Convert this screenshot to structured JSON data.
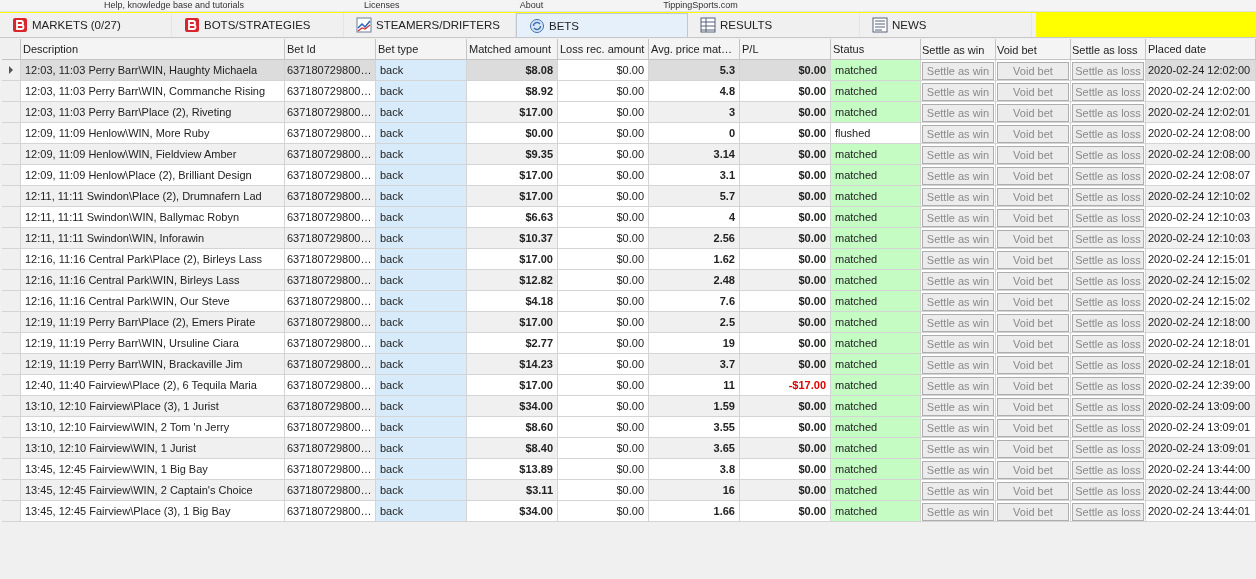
{
  "menu_strip": [
    "Help, knowledge base and tutorials",
    "Licenses",
    "About",
    "TippingSports.com"
  ],
  "tabs": [
    {
      "label": "MARKETS (0/27)",
      "kind": "brand",
      "selected": false
    },
    {
      "label": "BOTS/STRATEGIES",
      "kind": "brand",
      "selected": false
    },
    {
      "label": "STEAMERS/DRIFTERS",
      "kind": "chart",
      "selected": false
    },
    {
      "label": "BETS",
      "kind": "cycle",
      "selected": true
    },
    {
      "label": "RESULTS",
      "kind": "table",
      "selected": false
    },
    {
      "label": "NEWS",
      "kind": "news",
      "selected": false
    }
  ],
  "table": {
    "columns": [
      "Description",
      "Bet Id",
      "Bet type",
      "Matched amount",
      "Loss rec. amount",
      "Avg. price mat…",
      "P/L",
      "Status",
      "Settle as win",
      "Void bet",
      "Settle as loss",
      "Placed date"
    ],
    "rows": [
      {
        "selected": true,
        "description": "12:03, 11:03 Perry Barr\\WIN, Haughty Michaela",
        "bet_id": "637180729800…",
        "bet_type": "back",
        "matched": "$8.08",
        "loss_rec": "$0.00",
        "avg_price": "5.3",
        "pl": "$0.00",
        "pl_negative": false,
        "status": "matched",
        "status_highlight": true,
        "actions": [
          {
            "label": "Settle as win",
            "disabled": true
          },
          {
            "label": "Void bet",
            "disabled": true
          },
          {
            "label": "Settle as loss",
            "disabled": true
          }
        ],
        "placed": "2020-02-24 12:02:00"
      },
      {
        "selected": false,
        "description": "12:03, 11:03 Perry Barr\\WIN, Commanche Rising",
        "bet_id": "637180729800…",
        "bet_type": "back",
        "matched": "$8.92",
        "loss_rec": "$0.00",
        "avg_price": "4.8",
        "pl": "$0.00",
        "pl_negative": false,
        "status": "matched",
        "status_highlight": true,
        "actions": [
          {
            "label": "Settle as win",
            "disabled": true
          },
          {
            "label": "Void bet",
            "disabled": true
          },
          {
            "label": "Settle as loss",
            "disabled": true
          }
        ],
        "placed": "2020-02-24 12:02:00"
      },
      {
        "selected": false,
        "description": "12:03, 11:03 Perry Barr\\Place (2), Riveting",
        "bet_id": "637180729800…",
        "bet_type": "back",
        "matched": "$17.00",
        "loss_rec": "$0.00",
        "avg_price": "3",
        "pl": "$0.00",
        "pl_negative": false,
        "status": "matched",
        "status_highlight": true,
        "actions": [
          {
            "label": "Settle as win",
            "disabled": true
          },
          {
            "label": "Void bet",
            "disabled": true
          },
          {
            "label": "Settle as loss",
            "disabled": true
          }
        ],
        "placed": "2020-02-24 12:02:01"
      },
      {
        "selected": false,
        "description": "12:09, 11:09 Henlow\\WIN, More Ruby",
        "bet_id": "637180729800…",
        "bet_type": "back",
        "matched": "$0.00",
        "loss_rec": "$0.00",
        "avg_price": "0",
        "pl": "$0.00",
        "pl_negative": false,
        "status": "flushed",
        "status_highlight": false,
        "actions": [
          {
            "label": "Settle as win",
            "disabled": true
          },
          {
            "label": "Void bet",
            "disabled": true
          },
          {
            "label": "Settle as loss",
            "disabled": true
          }
        ],
        "placed": "2020-02-24 12:08:00"
      },
      {
        "selected": false,
        "description": "12:09, 11:09 Henlow\\WIN, Fieldview Amber",
        "bet_id": "637180729800…",
        "bet_type": "back",
        "matched": "$9.35",
        "loss_rec": "$0.00",
        "avg_price": "3.14",
        "pl": "$0.00",
        "pl_negative": false,
        "status": "matched",
        "status_highlight": true,
        "actions": [
          {
            "label": "Settle as win",
            "disabled": true
          },
          {
            "label": "Void bet",
            "disabled": true
          },
          {
            "label": "Settle as loss",
            "disabled": true
          }
        ],
        "placed": "2020-02-24 12:08:00"
      },
      {
        "selected": false,
        "description": "12:09, 11:09 Henlow\\Place (2), Brilliant Design",
        "bet_id": "637180729800…",
        "bet_type": "back",
        "matched": "$17.00",
        "loss_rec": "$0.00",
        "avg_price": "3.1",
        "pl": "$0.00",
        "pl_negative": false,
        "status": "matched",
        "status_highlight": true,
        "actions": [
          {
            "label": "Settle as win",
            "disabled": true
          },
          {
            "label": "Void bet",
            "disabled": true
          },
          {
            "label": "Settle as loss",
            "disabled": true
          }
        ],
        "placed": "2020-02-24 12:08:07"
      },
      {
        "selected": false,
        "description": "12:11, 11:11 Swindon\\Place (2), Drumnafern Lad",
        "bet_id": "637180729800…",
        "bet_type": "back",
        "matched": "$17.00",
        "loss_rec": "$0.00",
        "avg_price": "5.7",
        "pl": "$0.00",
        "pl_negative": false,
        "status": "matched",
        "status_highlight": true,
        "actions": [
          {
            "label": "Settle as win",
            "disabled": true
          },
          {
            "label": "Void bet",
            "disabled": true
          },
          {
            "label": "Settle as loss",
            "disabled": true
          }
        ],
        "placed": "2020-02-24 12:10:02"
      },
      {
        "selected": false,
        "description": "12:11, 11:11 Swindon\\WIN, Ballymac Robyn",
        "bet_id": "637180729800…",
        "bet_type": "back",
        "matched": "$6.63",
        "loss_rec": "$0.00",
        "avg_price": "4",
        "pl": "$0.00",
        "pl_negative": false,
        "status": "matched",
        "status_highlight": true,
        "actions": [
          {
            "label": "Settle as win",
            "disabled": true
          },
          {
            "label": "Void bet",
            "disabled": true
          },
          {
            "label": "Settle as loss",
            "disabled": true
          }
        ],
        "placed": "2020-02-24 12:10:03"
      },
      {
        "selected": false,
        "description": "12:11, 11:11 Swindon\\WIN, Inforawin",
        "bet_id": "637180729800…",
        "bet_type": "back",
        "matched": "$10.37",
        "loss_rec": "$0.00",
        "avg_price": "2.56",
        "pl": "$0.00",
        "pl_negative": false,
        "status": "matched",
        "status_highlight": true,
        "actions": [
          {
            "label": "Settle as win",
            "disabled": true
          },
          {
            "label": "Void bet",
            "disabled": true
          },
          {
            "label": "Settle as loss",
            "disabled": true
          }
        ],
        "placed": "2020-02-24 12:10:03"
      },
      {
        "selected": false,
        "description": "12:16, 11:16 Central Park\\Place (2), Birleys Lass",
        "bet_id": "637180729800…",
        "bet_type": "back",
        "matched": "$17.00",
        "loss_rec": "$0.00",
        "avg_price": "1.62",
        "pl": "$0.00",
        "pl_negative": false,
        "status": "matched",
        "status_highlight": true,
        "actions": [
          {
            "label": "Settle as win",
            "disabled": true
          },
          {
            "label": "Void bet",
            "disabled": true
          },
          {
            "label": "Settle as loss",
            "disabled": true
          }
        ],
        "placed": "2020-02-24 12:15:01"
      },
      {
        "selected": false,
        "description": "12:16, 11:16 Central Park\\WIN, Birleys Lass",
        "bet_id": "637180729800…",
        "bet_type": "back",
        "matched": "$12.82",
        "loss_rec": "$0.00",
        "avg_price": "2.48",
        "pl": "$0.00",
        "pl_negative": false,
        "status": "matched",
        "status_highlight": true,
        "actions": [
          {
            "label": "Settle as win",
            "disabled": true
          },
          {
            "label": "Void bet",
            "disabled": true
          },
          {
            "label": "Settle as loss",
            "disabled": true
          }
        ],
        "placed": "2020-02-24 12:15:02"
      },
      {
        "selected": false,
        "description": "12:16, 11:16 Central Park\\WIN, Our Steve",
        "bet_id": "637180729800…",
        "bet_type": "back",
        "matched": "$4.18",
        "loss_rec": "$0.00",
        "avg_price": "7.6",
        "pl": "$0.00",
        "pl_negative": false,
        "status": "matched",
        "status_highlight": true,
        "actions": [
          {
            "label": "Settle as win",
            "disabled": true
          },
          {
            "label": "Void bet",
            "disabled": true
          },
          {
            "label": "Settle as loss",
            "disabled": true
          }
        ],
        "placed": "2020-02-24 12:15:02"
      },
      {
        "selected": false,
        "description": "12:19, 11:19 Perry Barr\\Place (2), Emers Pirate",
        "bet_id": "637180729800…",
        "bet_type": "back",
        "matched": "$17.00",
        "loss_rec": "$0.00",
        "avg_price": "2.5",
        "pl": "$0.00",
        "pl_negative": false,
        "status": "matched",
        "status_highlight": true,
        "actions": [
          {
            "label": "Settle as win",
            "disabled": true
          },
          {
            "label": "Void bet",
            "disabled": true
          },
          {
            "label": "Settle as loss",
            "disabled": true
          }
        ],
        "placed": "2020-02-24 12:18:00"
      },
      {
        "selected": false,
        "description": "12:19, 11:19 Perry Barr\\WIN, Ursuline Ciara",
        "bet_id": "637180729800…",
        "bet_type": "back",
        "matched": "$2.77",
        "loss_rec": "$0.00",
        "avg_price": "19",
        "pl": "$0.00",
        "pl_negative": false,
        "status": "matched",
        "status_highlight": true,
        "actions": [
          {
            "label": "Settle as win",
            "disabled": true
          },
          {
            "label": "Void bet",
            "disabled": true
          },
          {
            "label": "Settle as loss",
            "disabled": true
          }
        ],
        "placed": "2020-02-24 12:18:01"
      },
      {
        "selected": false,
        "description": "12:19, 11:19 Perry Barr\\WIN, Brackaville Jim",
        "bet_id": "637180729800…",
        "bet_type": "back",
        "matched": "$14.23",
        "loss_rec": "$0.00",
        "avg_price": "3.7",
        "pl": "$0.00",
        "pl_negative": false,
        "status": "matched",
        "status_highlight": true,
        "actions": [
          {
            "label": "Settle as win",
            "disabled": true
          },
          {
            "label": "Void bet",
            "disabled": true
          },
          {
            "label": "Settle as loss",
            "disabled": true
          }
        ],
        "placed": "2020-02-24 12:18:01"
      },
      {
        "selected": false,
        "description": "12:40, 11:40 Fairview\\Place (2), 6 Tequila Maria",
        "bet_id": "637180729800…",
        "bet_type": "back",
        "matched": "$17.00",
        "loss_rec": "$0.00",
        "avg_price": "11",
        "pl": "-$17.00",
        "pl_negative": true,
        "status": "matched",
        "status_highlight": true,
        "actions": [
          {
            "label": "Settle as win",
            "disabled": true
          },
          {
            "label": "Void bet",
            "disabled": true
          },
          {
            "label": "Settle as loss",
            "disabled": true
          }
        ],
        "placed": "2020-02-24 12:39:00"
      },
      {
        "selected": false,
        "description": "13:10, 12:10 Fairview\\Place (3), 1 Jurist",
        "bet_id": "637180729800…",
        "bet_type": "back",
        "matched": "$34.00",
        "loss_rec": "$0.00",
        "avg_price": "1.59",
        "pl": "$0.00",
        "pl_negative": false,
        "status": "matched",
        "status_highlight": true,
        "actions": [
          {
            "label": "Settle as win",
            "disabled": true
          },
          {
            "label": "Void bet",
            "disabled": true
          },
          {
            "label": "Settle as loss",
            "disabled": true
          }
        ],
        "placed": "2020-02-24 13:09:00"
      },
      {
        "selected": false,
        "description": "13:10, 12:10 Fairview\\WIN, 2 Tom 'n Jerry",
        "bet_id": "637180729800…",
        "bet_type": "back",
        "matched": "$8.60",
        "loss_rec": "$0.00",
        "avg_price": "3.55",
        "pl": "$0.00",
        "pl_negative": false,
        "status": "matched",
        "status_highlight": true,
        "actions": [
          {
            "label": "Settle as win",
            "disabled": true
          },
          {
            "label": "Void bet",
            "disabled": true
          },
          {
            "label": "Settle as loss",
            "disabled": true
          }
        ],
        "placed": "2020-02-24 13:09:01"
      },
      {
        "selected": false,
        "description": "13:10, 12:10 Fairview\\WIN, 1 Jurist",
        "bet_id": "637180729800…",
        "bet_type": "back",
        "matched": "$8.40",
        "loss_rec": "$0.00",
        "avg_price": "3.65",
        "pl": "$0.00",
        "pl_negative": false,
        "status": "matched",
        "status_highlight": true,
        "actions": [
          {
            "label": "Settle as win",
            "disabled": true
          },
          {
            "label": "Void bet",
            "disabled": true
          },
          {
            "label": "Settle as loss",
            "disabled": true
          }
        ],
        "placed": "2020-02-24 13:09:01"
      },
      {
        "selected": false,
        "description": "13:45, 12:45 Fairview\\WIN, 1 Big Bay",
        "bet_id": "637180729800…",
        "bet_type": "back",
        "matched": "$13.89",
        "loss_rec": "$0.00",
        "avg_price": "3.8",
        "pl": "$0.00",
        "pl_negative": false,
        "status": "matched",
        "status_highlight": true,
        "actions": [
          {
            "label": "Settle as win",
            "disabled": true
          },
          {
            "label": "Void bet",
            "disabled": true
          },
          {
            "label": "Settle as loss",
            "disabled": true
          }
        ],
        "placed": "2020-02-24 13:44:00"
      },
      {
        "selected": false,
        "description": "13:45, 12:45 Fairview\\WIN, 2 Captain's Choice",
        "bet_id": "637180729800…",
        "bet_type": "back",
        "matched": "$3.11",
        "loss_rec": "$0.00",
        "avg_price": "16",
        "pl": "$0.00",
        "pl_negative": false,
        "status": "matched",
        "status_highlight": true,
        "actions": [
          {
            "label": "Settle as win",
            "disabled": true
          },
          {
            "label": "Void bet",
            "disabled": true
          },
          {
            "label": "Settle as loss",
            "disabled": true
          }
        ],
        "placed": "2020-02-24 13:44:00"
      },
      {
        "selected": false,
        "description": "13:45, 12:45 Fairview\\Place (3), 1 Big Bay",
        "bet_id": "637180729800…",
        "bet_type": "back",
        "matched": "$34.00",
        "loss_rec": "$0.00",
        "avg_price": "1.66",
        "pl": "$0.00",
        "pl_negative": false,
        "status": "matched",
        "status_highlight": true,
        "actions": [
          {
            "label": "Settle as win",
            "disabled": true
          },
          {
            "label": "Void bet",
            "disabled": true
          },
          {
            "label": "Settle as loss",
            "disabled": true
          }
        ],
        "placed": "2020-02-24 13:44:01"
      }
    ]
  }
}
